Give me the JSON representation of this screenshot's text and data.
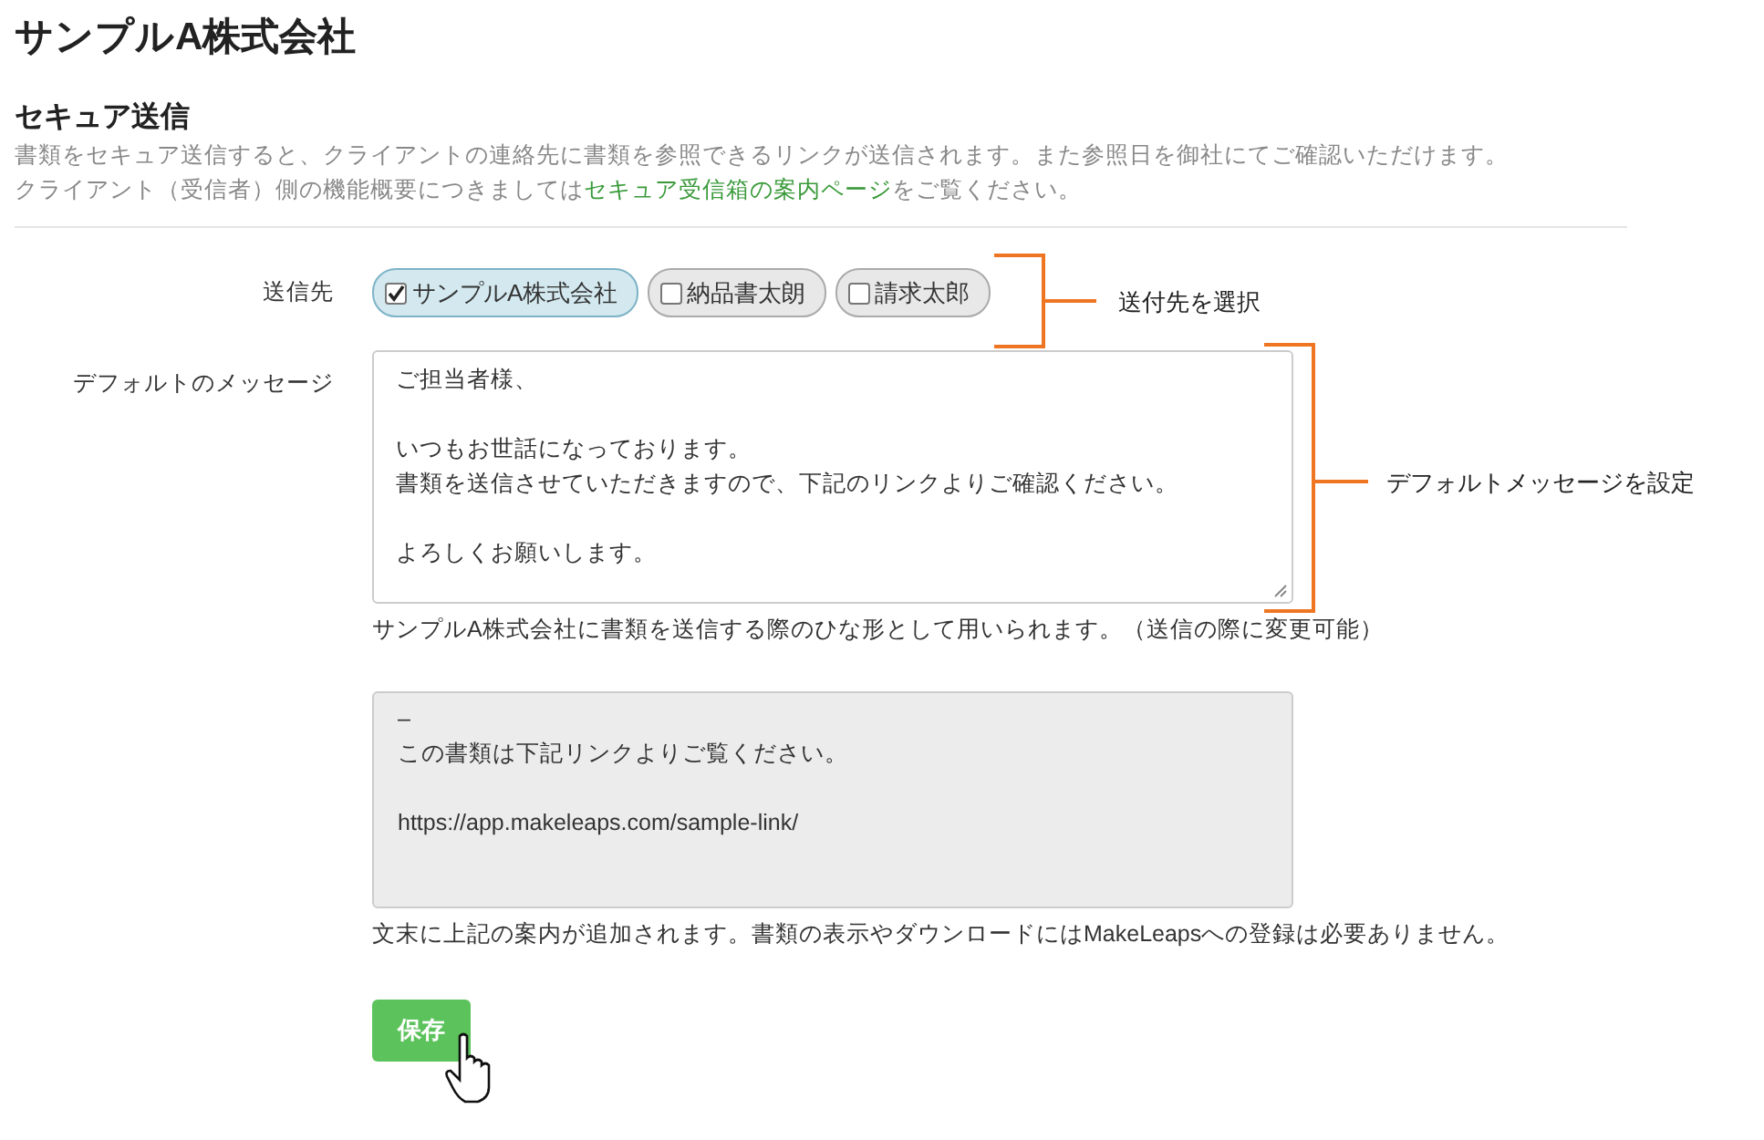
{
  "page_title": "サンプルA株式会社",
  "section": {
    "heading": "セキュア送信",
    "description": "書類をセキュア送信すると、クライアントの連絡先に書類を参照できるリンクが送信されます。また参照日を御社にてご確認いただけます。",
    "note_before": "クライアント（受信者）側の機能概要につきましては",
    "note_link": "セキュア受信箱の案内ページ",
    "note_after": "をご覧ください。"
  },
  "recipients": {
    "label": "送信先",
    "items": [
      {
        "label": "サンプルA株式会社",
        "checked": true
      },
      {
        "label": "納品書太朗",
        "checked": false
      },
      {
        "label": "請求太郎",
        "checked": false
      }
    ]
  },
  "message": {
    "label": "デフォルトのメッセージ",
    "paragraphs": [
      [
        "ご担当者様、"
      ],
      [
        "いつもお世話になっております。",
        "書類を送信させていただきますので、下記のリンクよりご確認ください。"
      ],
      [
        "よろしくお願いします。"
      ]
    ],
    "hint": "サンプルA株式会社に書類を送信する際のひな形として用いられます。（送信の際に変更可能）"
  },
  "signature": {
    "paragraphs": [
      [
        "–",
        "この書類は下記リンクよりご覧ください。"
      ],
      [
        "https://app.makeleaps.com/sample-link/"
      ]
    ],
    "hint": "文末に上記の案内が追加されます。書類の表示やダウンロードにはMakeLeapsへの登録は必要ありません。"
  },
  "save_button": "保存",
  "annotations": [
    {
      "label": "送付先を選択"
    },
    {
      "label": "デフォルトメッセージを設定"
    }
  ]
}
